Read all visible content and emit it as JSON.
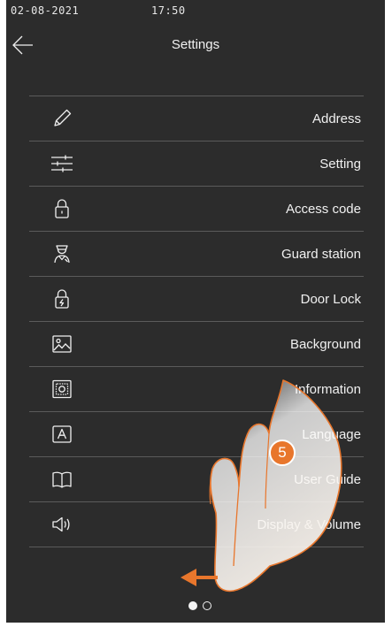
{
  "status": {
    "date": "02-08-2021",
    "time": "17:50"
  },
  "header": {
    "title": "Settings",
    "back_icon": "arrow-left-icon"
  },
  "menu": [
    {
      "label": "Address",
      "icon": "pencil-icon"
    },
    {
      "label": "Setting",
      "icon": "sliders-icon"
    },
    {
      "label": "Access code",
      "icon": "padlock-icon"
    },
    {
      "label": "Guard station",
      "icon": "guard-icon"
    },
    {
      "label": "Door Lock",
      "icon": "lock-bolt-icon"
    },
    {
      "label": "Background",
      "icon": "image-icon"
    },
    {
      "label": "Information",
      "icon": "info-chip-icon"
    },
    {
      "label": "Language",
      "icon": "letter-a-icon"
    },
    {
      "label": "User Guide",
      "icon": "book-icon"
    },
    {
      "label": "Display & Volume",
      "icon": "speaker-icon"
    }
  ],
  "pagination": {
    "current": 1,
    "total": 2
  },
  "instruction": {
    "step": "5"
  },
  "colors": {
    "background": "#2c2c2c",
    "text": "#f0f0f0",
    "divider": "#5b5b5b",
    "accent": "#e8762c"
  }
}
